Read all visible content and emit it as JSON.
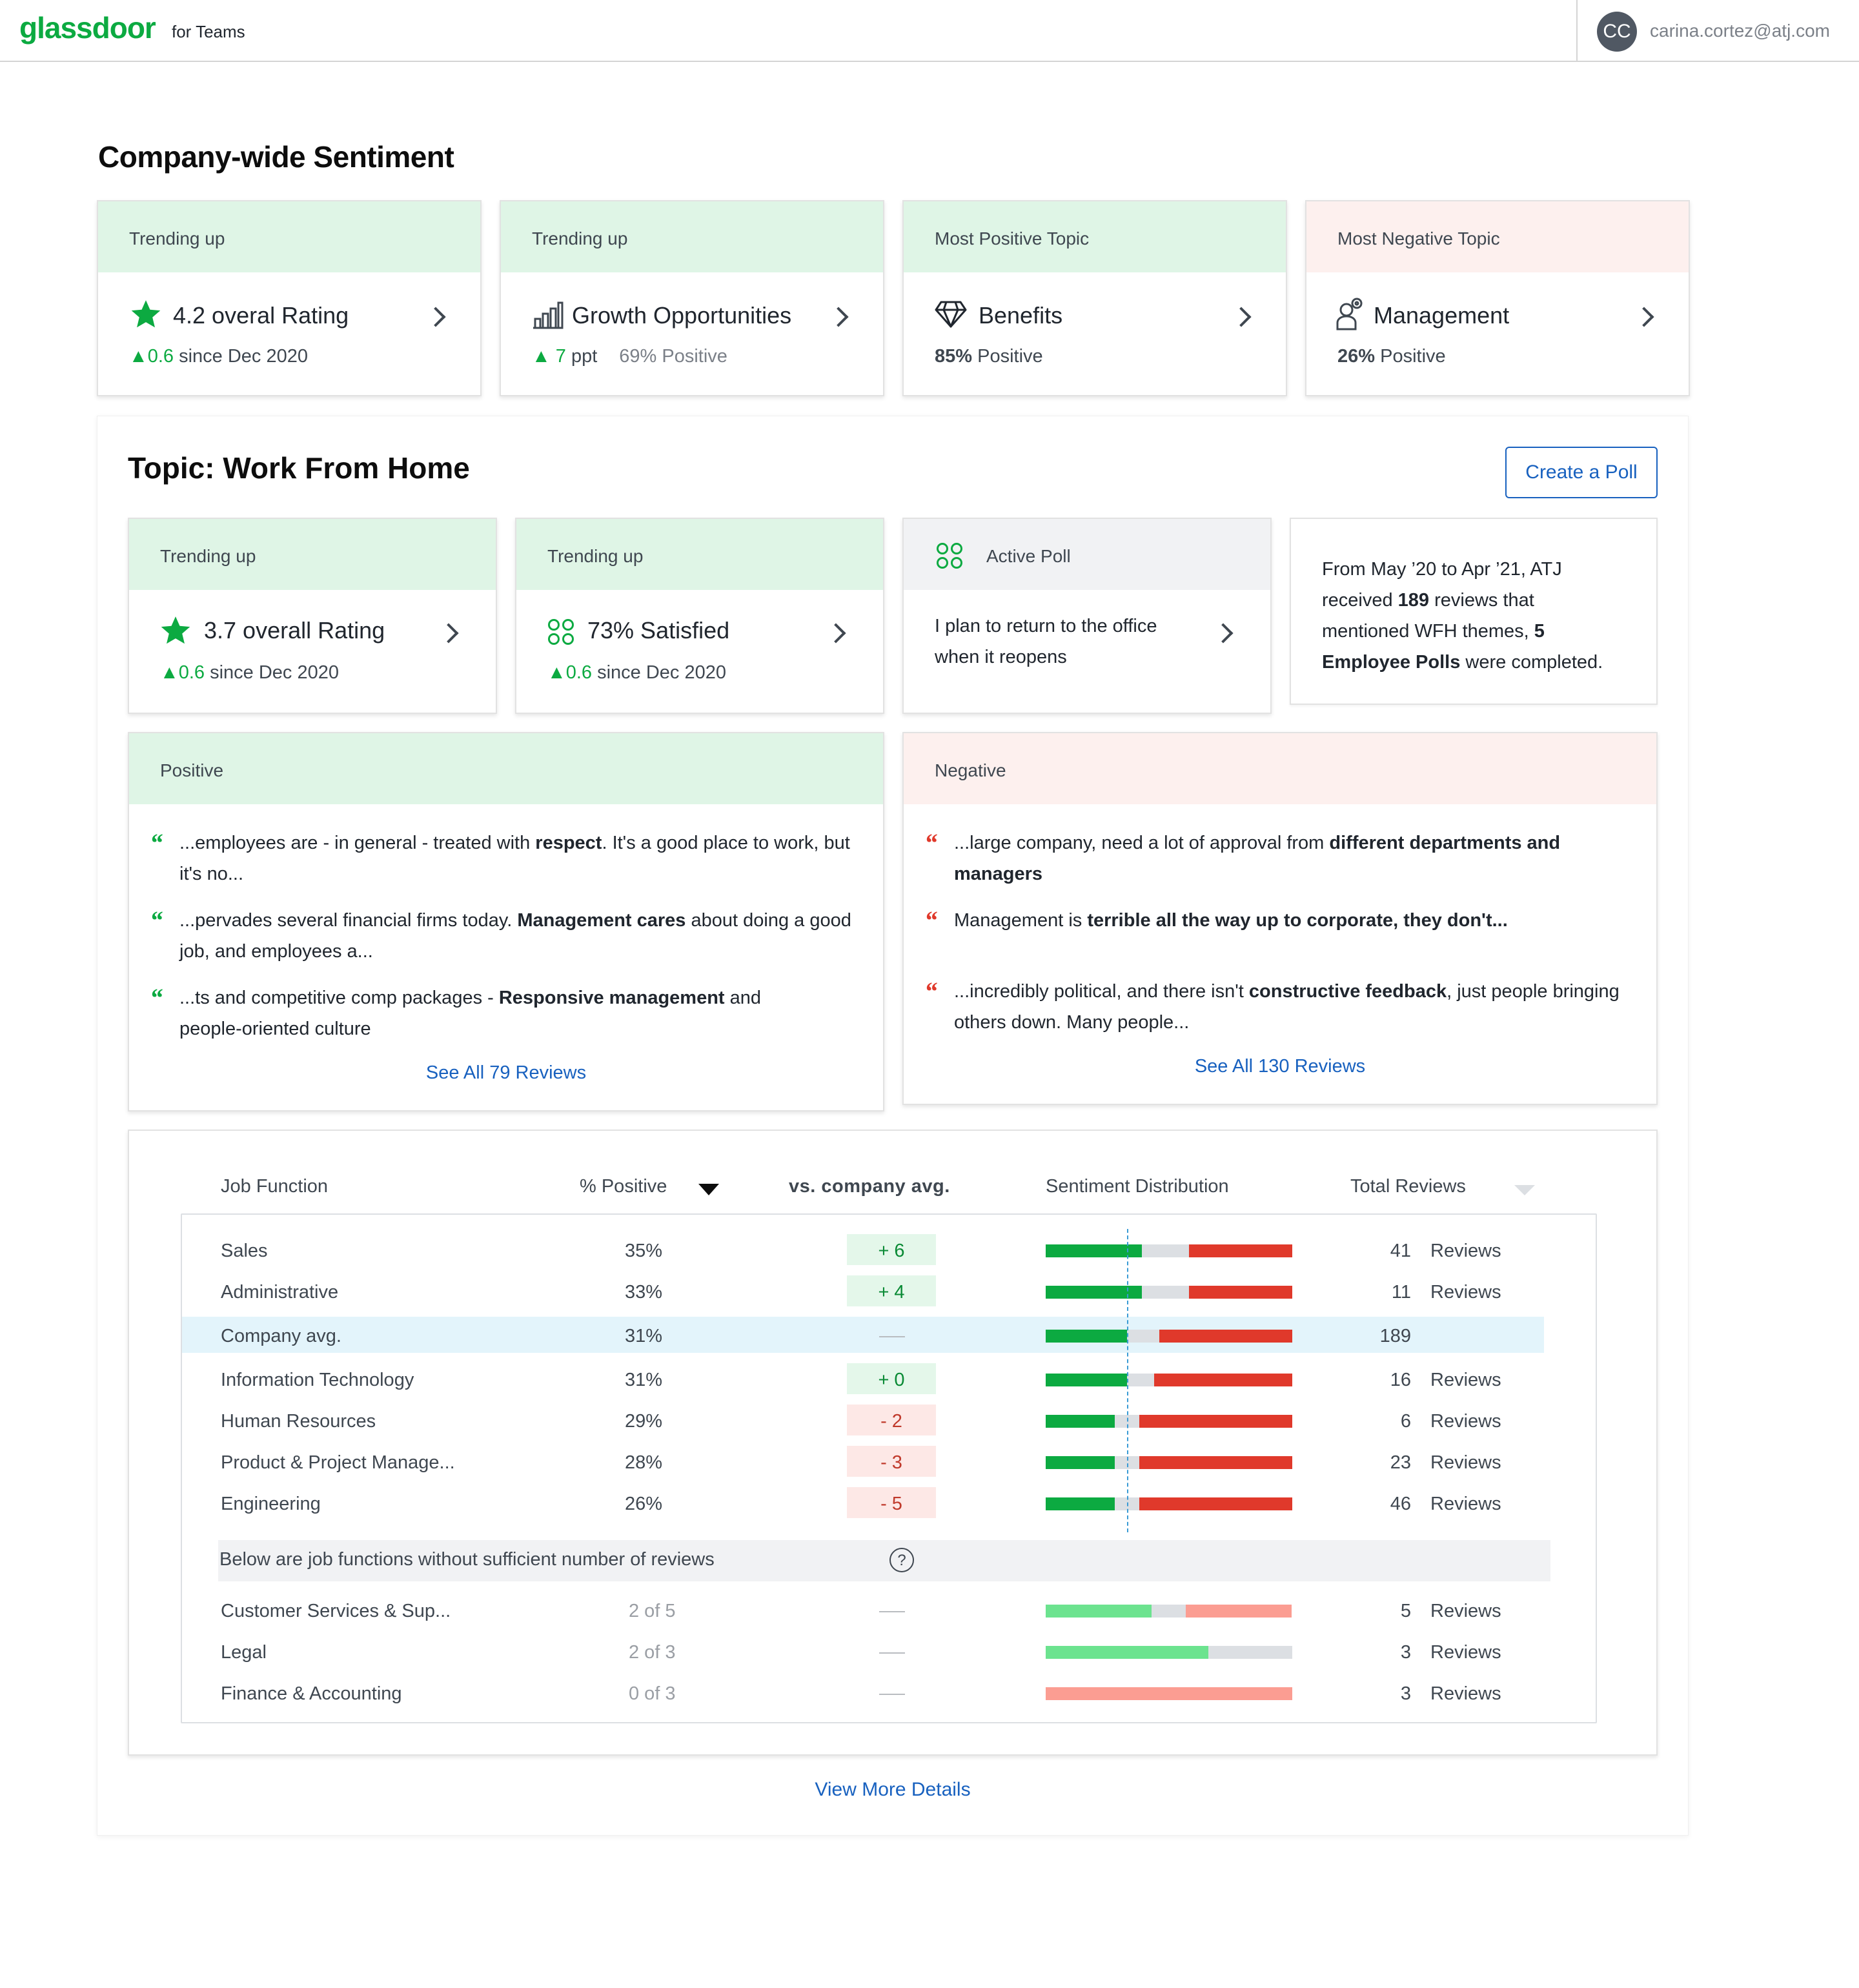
{
  "header": {
    "logo": "glassdoor",
    "logo_suffix": "for Teams",
    "avatar_initials": "CC",
    "user_email": "carina.cortez@atj.com"
  },
  "company_sentiment": {
    "title": "Company-wide Sentiment",
    "cards": [
      {
        "header": "Trending up",
        "title": "4.2 overal Rating",
        "delta": "0.6",
        "sub": "since Dec 2020",
        "icon": "star-icon"
      },
      {
        "header": "Trending up",
        "title": "Growth Opportunities",
        "delta": "7",
        "delta_unit": "ppt",
        "sub": "69% Positive",
        "icon": "bar-chart-icon"
      },
      {
        "header": "Most Positive Topic",
        "title": "Benefits",
        "pct": "85%",
        "sub": "Positive",
        "icon": "diamond-icon"
      },
      {
        "header": "Most Negative Topic",
        "title": "Management",
        "pct": "26%",
        "sub": "Positive",
        "icon": "manager-icon"
      }
    ]
  },
  "topic": {
    "title": "Topic: Work From Home",
    "create_poll": "Create a Poll",
    "cards": [
      {
        "header": "Trending up",
        "title": "3.7 overall Rating",
        "delta": "0.6",
        "sub": "since Dec 2020"
      },
      {
        "header": "Trending up",
        "title": "73% Satisfied",
        "delta": "0.6",
        "sub": "since Dec 2020"
      },
      {
        "header": "Active Poll",
        "text1": "I plan to return to the office",
        "text2": "when it reopens"
      }
    ],
    "summary": {
      "l1": "From May ’20 to Apr ’21, ATJ",
      "l2a": "received ",
      "l2b": "189",
      "l2c": " reviews that",
      "l3a": "mentioned WFH themes, ",
      "l3b": "5",
      "l4a": "Employee Polls",
      "l4b": " were completed."
    },
    "positive": {
      "header": "Positive",
      "q1a": "...employees are - in general - treated with ",
      "q1b": "respect",
      "q1c": ". It's a good place to work, but",
      "q1d": "it's no...",
      "q2a": "...pervades several financial firms today. ",
      "q2b": "Management cares",
      "q2c": " about doing a good",
      "q2d": "job, and employees a...",
      "q3a": "...ts and competitive comp packages - ",
      "q3b": "Responsive management",
      "q3c": " and",
      "q3d": "people-oriented culture",
      "link": "See All 79 Reviews"
    },
    "negative": {
      "header": "Negative",
      "q1a": "...large company, need a lot of approval from ",
      "q1b": "different departments and",
      "q1c": "managers",
      "q2a": "Management is ",
      "q2b": "terrible all the way up to corporate, they don't...",
      "q3a": "...incredibly political, and there isn't ",
      "q3b": "constructive feedback",
      "q3c": ", just people bringing",
      "q3d": "others down. Many people...",
      "link": "See All 130 Reviews"
    }
  },
  "table": {
    "headers": {
      "job": "Job Function",
      "pos": "% Positive",
      "vs": "vs. company avg.",
      "dist": "Sentiment Distribution",
      "total": "Total Reviews"
    },
    "rows": [
      {
        "name": "Sales",
        "pct": "35%",
        "delta": "+ 6",
        "total": "41",
        "link": "Reviews",
        "dist": [
          0.39,
          0.19,
          0.42
        ]
      },
      {
        "name": "Administrative",
        "pct": "33%",
        "delta": "+ 4",
        "total": "11",
        "link": "Reviews",
        "dist": [
          0.39,
          0.19,
          0.42
        ]
      },
      {
        "name": "Company avg.",
        "pct": "31%",
        "delta": "",
        "total": "189",
        "link": "",
        "dist": [
          0.33,
          0.13,
          0.54
        ]
      },
      {
        "name": "Information Technology",
        "pct": "31%",
        "delta": "+ 0",
        "total": "16",
        "link": "Reviews",
        "dist": [
          0.33,
          0.11,
          0.56
        ]
      },
      {
        "name": "Human Resources",
        "pct": "29%",
        "delta": "- 2",
        "total": "6",
        "link": "Reviews",
        "dist": [
          0.28,
          0.1,
          0.62
        ]
      },
      {
        "name": "Product & Project Manage...",
        "pct": "28%",
        "delta": "- 3",
        "total": "23",
        "link": "Reviews",
        "dist": [
          0.28,
          0.1,
          0.62
        ]
      },
      {
        "name": "Engineering",
        "pct": "26%",
        "delta": "- 5",
        "total": "46",
        "link": "Reviews",
        "dist": [
          0.28,
          0.1,
          0.62
        ]
      }
    ],
    "insufficient_label": "Below are job functions without sufficient number of reviews",
    "insufficient_rows": [
      {
        "name": "Customer Services & Sup...",
        "pct": "2 of 5",
        "total": "5",
        "link": "Reviews",
        "dist": [
          0.43,
          0.14,
          0.43
        ]
      },
      {
        "name": "Legal",
        "pct": "2 of 3",
        "total": "3",
        "link": "Reviews",
        "dist": [
          0.66,
          0.34,
          0
        ]
      },
      {
        "name": "Finance & Accounting",
        "pct": "0 of 3",
        "total": "3",
        "link": "Reviews",
        "dist": [
          0,
          0,
          1
        ]
      }
    ],
    "view_more": "View More Details"
  },
  "colors": {
    "brand": "#0caa41",
    "link": "#1861bf",
    "positive": "#0caa41",
    "negative": "#e0392b",
    "neutral": "#dcdfe3",
    "light_positive": "#6ce38f",
    "light_negative": "#fb9d92"
  }
}
